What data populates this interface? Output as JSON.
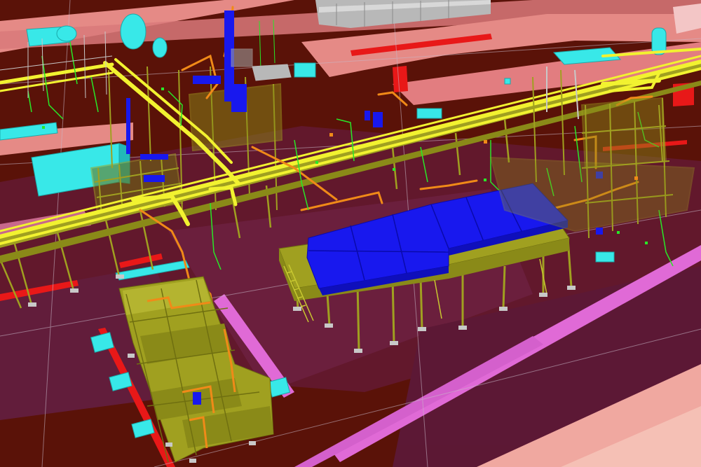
{
  "scene": {
    "description_visible_text": "",
    "colors": {
      "ground": "#5a1208",
      "ground_dark": "#3f0c06",
      "grid_line": "#c9b9c9",
      "road_pink": "#e58a86",
      "road_light": "#f0b5b0",
      "road_magenta": "#e06ad6",
      "steel_structure": "#a0a020",
      "steel_dark": "#6f6f10",
      "pipe_yellow": "#f2f230",
      "pipe_orange": "#f08a18",
      "pipe_green": "#28e828",
      "equipment_blue": "#1818ee",
      "equipment_cyan": "#38e8e8",
      "building_grey": "#b8b8b8",
      "red_marking": "#e81818",
      "footing_grey": "#c8c8c8"
    },
    "elements": [
      "ground-plane",
      "road-network",
      "pipe-rack-main",
      "steel-structure-left",
      "steel-structure-center-platform",
      "blue-roof-platform",
      "steel-structure-right",
      "skid-foreground",
      "cyan-equipment",
      "grey-building"
    ]
  }
}
